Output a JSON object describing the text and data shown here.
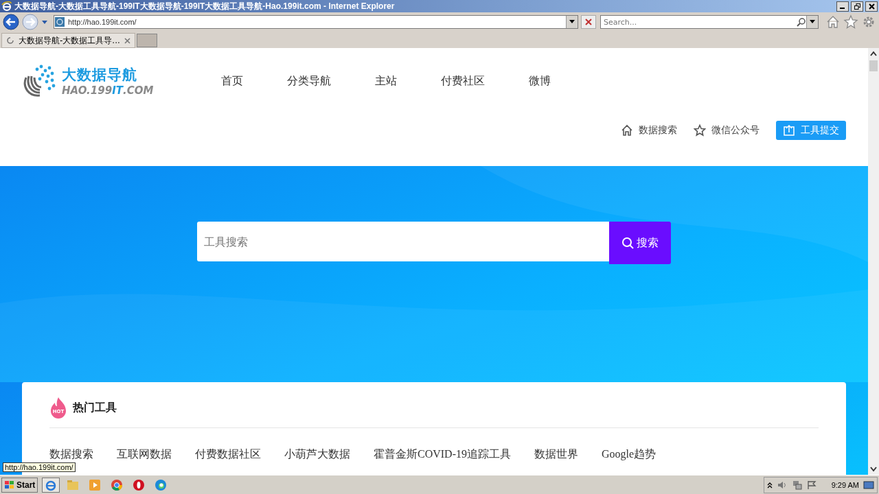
{
  "window": {
    "title": "大数据导航-大数据工具导航-199IT大数据导航-199IT大数据工具导航-Hao.199it.com - Internet Explorer"
  },
  "address_bar": {
    "url": "http://hao.199it.com/"
  },
  "search_box": {
    "placeholder": "Search..."
  },
  "tabs": [
    {
      "label": "大数据导航-大数据工具导...",
      "selected": true
    }
  ],
  "header": {
    "logo_title": "大数据导航",
    "logo_domain": "HAO.199**IT**.COM",
    "nav": [
      "首页",
      "分类导航",
      "主站",
      "付费社区",
      "微博"
    ],
    "links": [
      {
        "label": "数据搜索",
        "kind": "home"
      },
      {
        "label": "微信公众号",
        "kind": "star"
      }
    ],
    "submit_button": "工具提交"
  },
  "hero": {
    "search": {
      "placeholder": "工具搜索"
    },
    "button": "搜索"
  },
  "hot_tools": {
    "badge": "HOT",
    "title": "热门工具",
    "items": [
      "数据搜索",
      "互联网数据",
      "付费数据社区",
      "小葫芦大数据",
      "霍普金斯COVID-19追踪工具",
      "数据世界",
      "Google趋势"
    ]
  },
  "status_tooltip": "http://hao.199it.com/",
  "taskbar": {
    "start": "Start",
    "clock": "9:29 AM"
  }
}
